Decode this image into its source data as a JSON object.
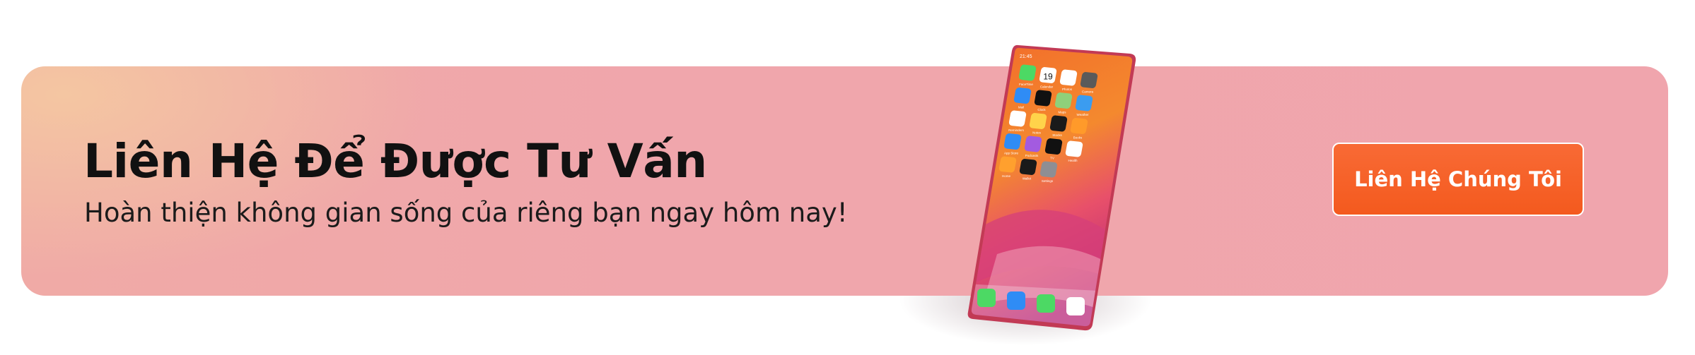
{
  "banner": {
    "title": "Liên Hệ Để Được Tư Vấn",
    "subtitle": "Hoàn thiện không gian sống của riêng bạn ngay hôm nay!",
    "cta_label": "Liên Hệ Chúng Tôi"
  },
  "phone": {
    "status_time": "21:45",
    "calendar_day": "19",
    "apps": [
      {
        "name": "FaceTime",
        "icon": "facetime-icon",
        "color": "#4cd964"
      },
      {
        "name": "Calendar",
        "icon": "calendar-icon",
        "color": "#ffffff"
      },
      {
        "name": "Photos",
        "icon": "photos-icon",
        "color": "#ffffff"
      },
      {
        "name": "Camera",
        "icon": "camera-icon",
        "color": "#5a5a5a"
      },
      {
        "name": "Mail",
        "icon": "mail-icon",
        "color": "#2f8cf5"
      },
      {
        "name": "Clock",
        "icon": "clock-icon",
        "color": "#111111"
      },
      {
        "name": "Maps",
        "icon": "maps-icon",
        "color": "#8fd07a"
      },
      {
        "name": "Weather",
        "icon": "weather-icon",
        "color": "#3b9cf0"
      },
      {
        "name": "Reminders",
        "icon": "reminders-icon",
        "color": "#ffffff"
      },
      {
        "name": "Notes",
        "icon": "notes-icon",
        "color": "#ffd34a"
      },
      {
        "name": "Stocks",
        "icon": "stocks-icon",
        "color": "#1a1a1a"
      },
      {
        "name": "Books",
        "icon": "books-icon",
        "color": "#ff9a2a"
      },
      {
        "name": "App Store",
        "icon": "app-store-icon",
        "color": "#2f8cf5"
      },
      {
        "name": "Podcasts",
        "icon": "podcasts-icon",
        "color": "#a35be0"
      },
      {
        "name": "TV",
        "icon": "tv-icon",
        "color": "#111111"
      },
      {
        "name": "Health",
        "icon": "health-icon",
        "color": "#ffffff"
      },
      {
        "name": "Home",
        "icon": "home-icon",
        "color": "#ffa02e"
      },
      {
        "name": "Wallet",
        "icon": "wallet-icon",
        "color": "#1a1a1a"
      },
      {
        "name": "Settings",
        "icon": "settings-icon",
        "color": "#8e8e93"
      }
    ],
    "dock": [
      {
        "icon": "phone-icon",
        "color": "#4cd964"
      },
      {
        "icon": "safari-icon",
        "color": "#2f8cf5"
      },
      {
        "icon": "messages-icon",
        "color": "#4cd964"
      },
      {
        "icon": "music-icon",
        "color": "#ffffff"
      }
    ]
  }
}
